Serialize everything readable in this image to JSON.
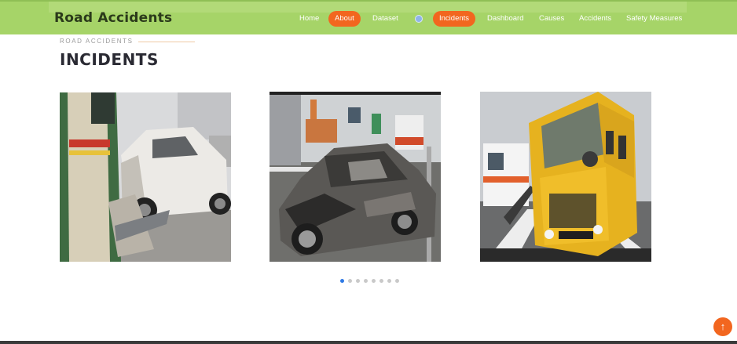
{
  "brand": "Road Accidents",
  "nav": {
    "items": [
      {
        "label": "Home",
        "active": false
      },
      {
        "label": "About",
        "active": true
      },
      {
        "label": "Dataset",
        "active": false
      },
      {
        "label": "Incidents",
        "active": true
      },
      {
        "label": "Dashboard",
        "active": false
      },
      {
        "label": "Causes",
        "active": false
      },
      {
        "label": "Accidents",
        "active": false
      },
      {
        "label": "Safety Measures",
        "active": false
      }
    ]
  },
  "section": {
    "subtitle": "ROAD ACCIDENTS",
    "title": "INCIDENTS"
  },
  "carousel": {
    "images": [
      {
        "name": "car-crushed-by-bus-image"
      },
      {
        "name": "burnt-car-image"
      },
      {
        "name": "school-bus-crash-image"
      }
    ],
    "active_index": 0,
    "dot_count": 8
  },
  "back_to_top": "↑",
  "colors": {
    "header": "#a6d468",
    "accent": "#f2661f",
    "active_dot": "#2f7ae5"
  }
}
